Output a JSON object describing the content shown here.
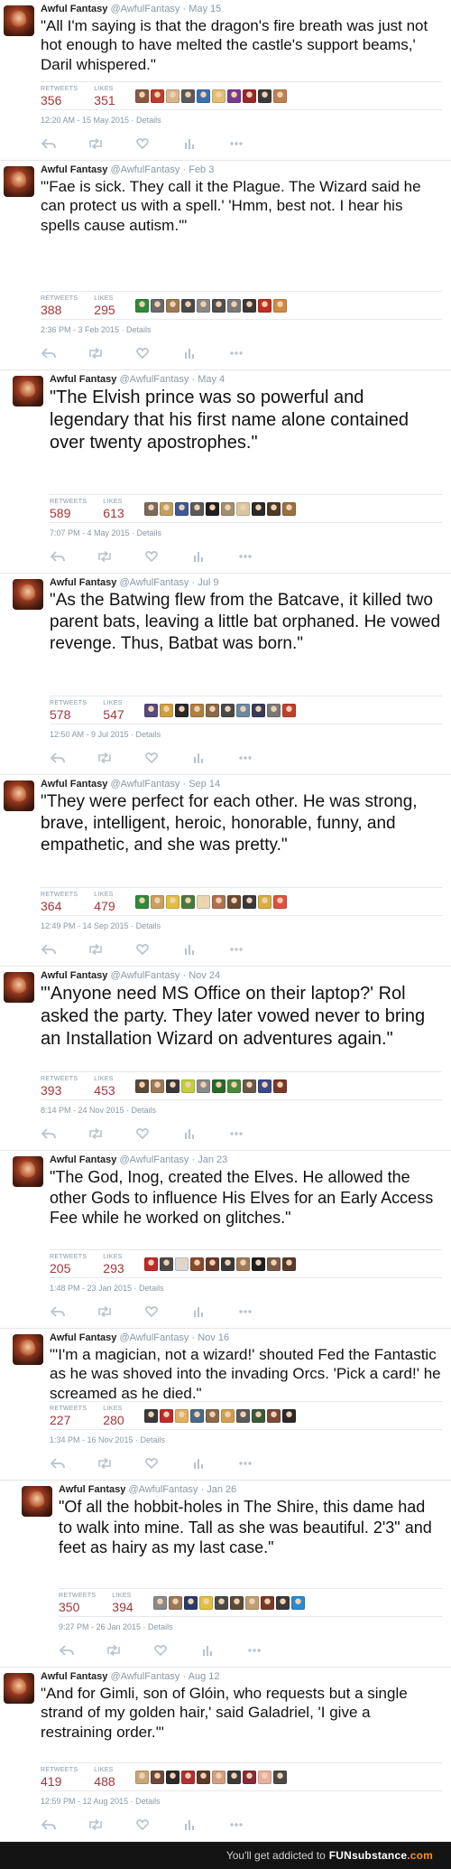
{
  "author": {
    "name": "Awful Fantasy",
    "handle": "@AwfulFantasy"
  },
  "labels": {
    "retweets": "RETWEETS",
    "likes": "LIKES"
  },
  "tweets": [
    {
      "date": "May 15",
      "text": "\"All I'm saying is that the dragon's fire breath was just not hot enough to have melted the castle's support beams,' Daril whispered.\"",
      "retweets": "356",
      "likes": "351",
      "timestamp": "12:20 AM - 15 May 2015 · Details",
      "faces": [
        "#8a5a40",
        "#c23a2a",
        "#d9b48c",
        "#5a5a5a",
        "#3b6fb0",
        "#e0c070",
        "#7a3a90",
        "#9a2a2a",
        "#3a3a3a",
        "#c08050"
      ]
    },
    {
      "date": "Feb 3",
      "text": "\"'Fae is sick. They call it the Plague. The Wizard said he can protect us with a spell.' 'Hmm, best not. I hear his spells cause autism.'\"",
      "retweets": "388",
      "likes": "295",
      "timestamp": "2:36 PM - 3 Feb 2015 · Details",
      "faces": [
        "#2f8a3a",
        "#6a6a6a",
        "#a07a50",
        "#4a4a4a",
        "#8a8a8a",
        "#505050",
        "#7a7a7a",
        "#3a3a3a",
        "#c03020",
        "#d08a40"
      ]
    },
    {
      "date": "May 4",
      "text": "\"The Elvish prince was so powerful and legendary that his first name alone contained over twenty apostrophes.\"",
      "retweets": "589",
      "likes": "613",
      "timestamp": "7:07 PM - 4 May 2015 · Details",
      "faces": [
        "#7a6a5a",
        "#c0a060",
        "#3a5a9a",
        "#5a5a5a",
        "#202020",
        "#a09070",
        "#d8c8a0",
        "#2a2a2a",
        "#4a3a2a",
        "#9a7040"
      ]
    },
    {
      "date": "Jul 9",
      "text": "\"As the Batwing flew from the Batcave, it killed two parent bats, leaving a little bat orphaned. He vowed revenge. Thus, Batbat was born.\"",
      "retweets": "578",
      "likes": "547",
      "timestamp": "12:50 AM - 9 Jul 2015 · Details",
      "faces": [
        "#5a4a7a",
        "#d0a040",
        "#2a2a2a",
        "#b08040",
        "#8a6a4a",
        "#4a4a4a",
        "#6a8aa0",
        "#3a3a5a",
        "#7a7a7a",
        "#c04030"
      ]
    },
    {
      "date": "Sep 14",
      "text": "\"They were perfect for each other. He was strong, brave, intelligent, heroic, honorable, funny, and empathetic, and she was pretty.\"",
      "retweets": "364",
      "likes": "479",
      "timestamp": "12:49 PM - 14 Sep 2015 · Details",
      "faces": [
        "#2f8a3a",
        "#c8a060",
        "#e0c040",
        "#4a7a3a",
        "#e8d8b0",
        "#b07050",
        "#6a4a30",
        "#3a3a3a",
        "#d8b040",
        "#e05040"
      ]
    },
    {
      "date": "Nov 24",
      "text": "\"'Anyone need MS Office on their laptop?' Rol asked the party. They later vowed never to bring an Installation Wizard on adventures again.\"",
      "retweets": "393",
      "likes": "453",
      "timestamp": "8:14 PM - 24 Nov 2015 · Details",
      "faces": [
        "#5a4a3a",
        "#9a7a5a",
        "#3a3a3a",
        "#c0d040",
        "#8a8a8a",
        "#2a6a2a",
        "#4a8a3a",
        "#6a5a4a",
        "#3a4a8a",
        "#7a3a2a"
      ]
    },
    {
      "date": "Jan 23",
      "text": "\"The God, Inog, created the Elves. He allowed the other Gods to influence His Elves for an Early Access Fee while he worked on glitches.\"",
      "retweets": "205",
      "likes": "293",
      "timestamp": "1:48 PM - 23 Jan 2015 · Details",
      "faces": [
        "#c02a2a",
        "#4a4a4a",
        "#d8d8d8",
        "#8a4a2a",
        "#6a3a2a",
        "#3a3a3a",
        "#a07a5a",
        "#202020",
        "#7a5a4a",
        "#5a3a2a"
      ]
    },
    {
      "date": "Nov 16",
      "text": "\"'I'm a magician, not a wizard!' shouted Fed the Fantastic as he was shoved into the invading Orcs. 'Pick a card!' he screamed as he died.\"",
      "retweets": "227",
      "likes": "280",
      "timestamp": "1:34 PM - 16 Nov 2015 · Details",
      "faces": [
        "#3a3a3a",
        "#c02a2a",
        "#e0b060",
        "#4a6a8a",
        "#8a6a4a",
        "#d0a050",
        "#5a5a5a",
        "#3a5a3a",
        "#7a4a3a",
        "#2a2a2a"
      ]
    },
    {
      "date": "Jan 26",
      "text": "\"Of all the hobbit-holes in The Shire, this dame had to walk into mine. Tall as she was beautiful. 2'3\" and feet as hairy as my last case.\"",
      "retweets": "350",
      "likes": "394",
      "timestamp": "9:27 PM - 26 Jan 2015 · Details",
      "faces": [
        "#8a8a8a",
        "#9a7a5a",
        "#2a3a6a",
        "#e0c040",
        "#4a4a4a",
        "#5a4a3a",
        "#c0a070",
        "#7a3a2a",
        "#3a3a3a",
        "#2a8ad0"
      ]
    },
    {
      "date": "Aug 12",
      "text": "\"And for Gimli, son of Glóin, who requests but a single strand of my golden hair,' said Galadriel, 'I give a restraining order.'\"",
      "retweets": "419",
      "likes": "488",
      "timestamp": "12:59 PM - 12 Aug 2015 · Details",
      "faces": [
        "#c8a878",
        "#6a4a3a",
        "#2a2a2a",
        "#b03030",
        "#5a3a2a",
        "#d0a080",
        "#3a3a3a",
        "#8a2a3a",
        "#e8b0a0",
        "#4a4a4a"
      ]
    }
  ],
  "footer": {
    "prefix": "You'll get addicted to",
    "brand": "FUN",
    "brand_suffix": "substance",
    "brand_tld": ".com"
  }
}
